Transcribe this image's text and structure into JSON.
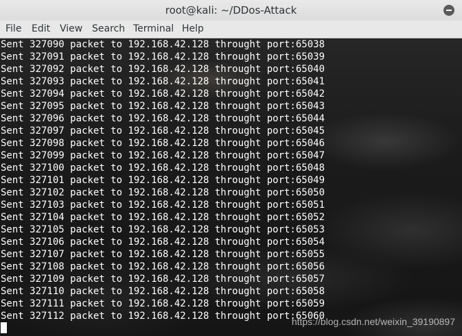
{
  "window": {
    "title": "root@kali: ~/DDos-Attack"
  },
  "titlebar": {
    "close_icon": "close-icon"
  },
  "menubar": {
    "items": [
      "File",
      "Edit",
      "View",
      "Search",
      "Terminal",
      "Help"
    ]
  },
  "terminal": {
    "lines": [
      "Sent 327090 packet to 192.168.42.128 throught port:65038",
      "Sent 327091 packet to 192.168.42.128 throught port:65039",
      "Sent 327092 packet to 192.168.42.128 throught port:65040",
      "Sent 327093 packet to 192.168.42.128 throught port:65041",
      "Sent 327094 packet to 192.168.42.128 throught port:65042",
      "Sent 327095 packet to 192.168.42.128 throught port:65043",
      "Sent 327096 packet to 192.168.42.128 throught port:65044",
      "Sent 327097 packet to 192.168.42.128 throught port:65045",
      "Sent 327098 packet to 192.168.42.128 throught port:65046",
      "Sent 327099 packet to 192.168.42.128 throught port:65047",
      "Sent 327100 packet to 192.168.42.128 throught port:65048",
      "Sent 327101 packet to 192.168.42.128 throught port:65049",
      "Sent 327102 packet to 192.168.42.128 throught port:65050",
      "Sent 327103 packet to 192.168.42.128 throught port:65051",
      "Sent 327104 packet to 192.168.42.128 throught port:65052",
      "Sent 327105 packet to 192.168.42.128 throught port:65053",
      "Sent 327106 packet to 192.168.42.128 throught port:65054",
      "Sent 327107 packet to 192.168.42.128 throught port:65055",
      "Sent 327108 packet to 192.168.42.128 throught port:65056",
      "Sent 327109 packet to 192.168.42.128 throught port:65057",
      "Sent 327110 packet to 192.168.42.128 throught port:65058",
      "Sent 327111 packet to 192.168.42.128 throught port:65059",
      "Sent 327112 packet to 192.168.42.128 throught port:65060"
    ],
    "text_color": "#ffffff"
  },
  "watermark": {
    "text": "https://blog.csdn.net/weixin_39190897"
  }
}
